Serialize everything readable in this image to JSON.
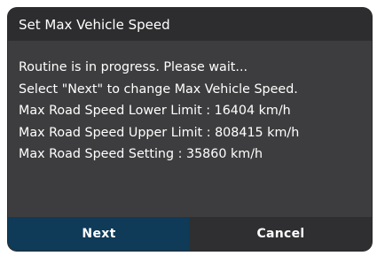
{
  "dialog": {
    "title": "Set Max Vehicle Speed",
    "lines": [
      "Routine is in progress. Please wait...",
      "Select \"Next\" to change Max Vehicle Speed.",
      "Max Road Speed Lower Limit : 16404 km/h",
      "Max Road Speed Upper Limit : 808415 km/h",
      "Max Road Speed Setting : 35860 km/h"
    ],
    "buttons": {
      "next": "Next",
      "cancel": "Cancel"
    }
  },
  "colors": {
    "dialog_bg": "#3d3d3f",
    "header_bg": "#2d2d2f",
    "next_bg": "#0f3a58",
    "cancel_bg": "#2f2f31",
    "text": "#ffffff"
  }
}
